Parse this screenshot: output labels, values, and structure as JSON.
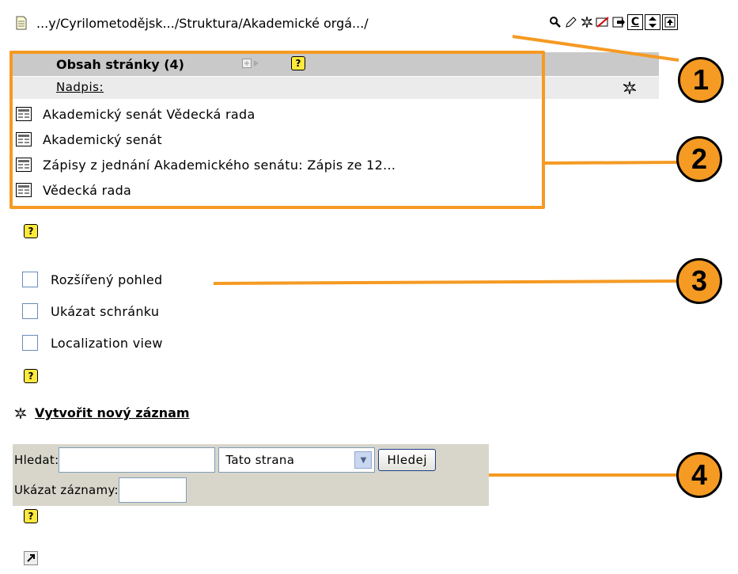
{
  "path": {
    "text": "...y/Cyrilometodějsk.../Struktura/Akademické orgá.../"
  },
  "toolbar": {
    "icons": [
      "magnify-icon",
      "edit-icon",
      "new-icon",
      "delete-icon",
      "move-icon",
      "copy-icon",
      "sort-icon",
      "up-icon"
    ],
    "copy_label": "C"
  },
  "content": {
    "title": "Obsah stránky (4)",
    "heading_label": "Nadpis:",
    "items": [
      {
        "label": "Akademický senát Vědecká rada"
      },
      {
        "label": "Akademický senát"
      },
      {
        "label": "Zápisy z jednání Akademického senátu: Zápis ze 12..."
      },
      {
        "label": "Vědecká rada"
      }
    ]
  },
  "options": {
    "extended_view": "Rozšířený pohled",
    "show_clipboard": "Ukázat schránku",
    "localization_view": "Localization view"
  },
  "create": {
    "label": "Vytvořit nový záznam"
  },
  "search": {
    "label": "Hledat:",
    "query": "",
    "scope_selected": "Tato strana",
    "button": "Hledej",
    "show_label": "Ukázat záznamy:",
    "show_value": ""
  },
  "help": {
    "glyph": "?"
  },
  "callouts": [
    "1",
    "2",
    "3",
    "4"
  ],
  "colors": {
    "callout": "#f59a23",
    "header_bg": "#c9c9c9",
    "search_bg": "#d8d6cb"
  }
}
